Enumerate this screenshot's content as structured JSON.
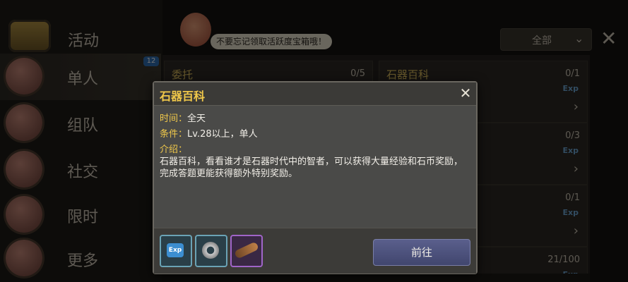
{
  "sidebar": {
    "header_label": "活动",
    "tabs": [
      {
        "label": "单人"
      },
      {
        "label": "组队"
      },
      {
        "label": "社交"
      },
      {
        "label": "限时"
      },
      {
        "label": "更多"
      }
    ],
    "badge": "12"
  },
  "top": {
    "speech": "不要忘记领取活跃度宝箱哦！",
    "filter_label": "全部"
  },
  "list": {
    "cards": [
      {
        "title": "委托",
        "progress": "0/5",
        "exp": ""
      },
      {
        "title": "石器百科",
        "progress": "0/1",
        "exp": "Exp"
      },
      {
        "title": "",
        "progress": "0/3",
        "exp": "Exp"
      },
      {
        "title": "",
        "progress": "0/1",
        "exp": "Exp"
      },
      {
        "title": "",
        "progress": "21/100",
        "exp": "Exp"
      }
    ]
  },
  "modal": {
    "title": "石器百科",
    "time_key": "时间：",
    "time_val": "全天",
    "cond_key": "条件：",
    "cond_val": "Lv.28以上，单人",
    "intro_key": "介绍：",
    "description": "石器百科，看看谁才是石器时代中的智者，可以获得大量经验和石币奖励，完成答题更能获得额外特别奖励。",
    "rewards": [
      {
        "icon": "exp-icon",
        "text": "Exp"
      },
      {
        "icon": "stone-coin-icon"
      },
      {
        "icon": "wooden-club-icon"
      }
    ],
    "go_button": "前往"
  }
}
